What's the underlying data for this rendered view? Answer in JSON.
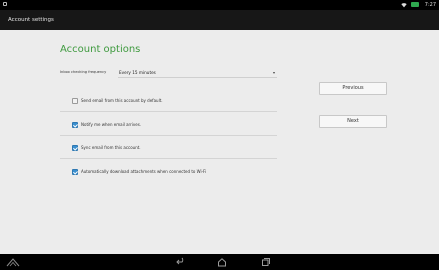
{
  "status_bar": {
    "time": "7:27",
    "icons": [
      "notification-icon",
      "wifi-icon",
      "battery-icon"
    ]
  },
  "action_bar": {
    "title": "Account settings"
  },
  "main": {
    "heading": "Account options",
    "frequency": {
      "label": "Inbox checking frequency",
      "value": "Every 15 minutes"
    },
    "options": [
      {
        "label": "Send email from this account by default.",
        "checked": false
      },
      {
        "label": "Notify me when email arrives.",
        "checked": true
      },
      {
        "label": "Sync email from this account.",
        "checked": true
      },
      {
        "label": "Automatically download attachments when connected to Wi-Fi",
        "checked": true
      }
    ]
  },
  "buttons": {
    "previous": "Previous",
    "next": "Next"
  },
  "nav_bar": {
    "icons": [
      "app-logo-icon",
      "back-icon",
      "home-icon",
      "recent-apps-icon"
    ]
  },
  "colors": {
    "accent": "#3f9a3f",
    "checkbox": "#3a8fcf",
    "action_bar": "#171717",
    "background": "#ececec"
  }
}
